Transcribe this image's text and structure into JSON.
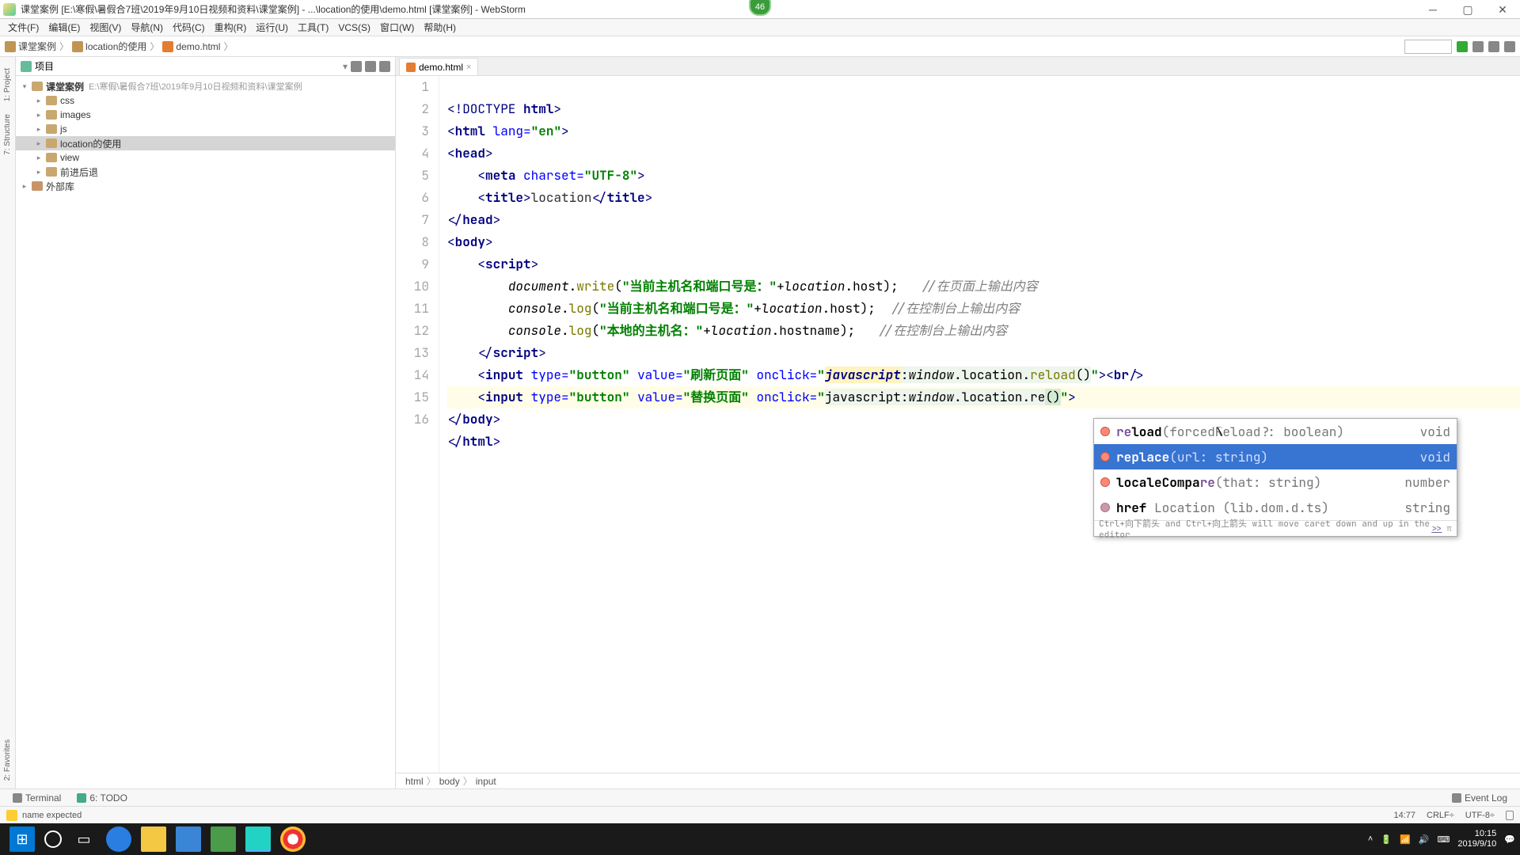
{
  "titlebar": {
    "text": "课堂案例 [E:\\寒假\\暑假合7班\\2019年9月10日视频和资料\\课堂案例] - ...\\location的使用\\demo.html [课堂案例] - WebStorm",
    "badge": "46"
  },
  "menu": {
    "file": "文件(F)",
    "edit": "编辑(E)",
    "view": "视图(V)",
    "navigate": "导航(N)",
    "code": "代码(C)",
    "refactor": "重构(R)",
    "run": "运行(U)",
    "tools": "工具(T)",
    "vcs": "VCS(S)",
    "window": "窗口(W)",
    "help": "帮助(H)"
  },
  "breadcrumbs": [
    "课堂案例",
    "location的使用",
    "demo.html"
  ],
  "toolbar_right_select": "",
  "left_rail": {
    "project": "1: Project",
    "structure": "7: Structure",
    "favorites": "2: Favorites"
  },
  "project_panel": {
    "title": "项目",
    "root": {
      "label": "课堂案例",
      "path": "E:\\寒假\\暑假合7班\\2019年9月10日视频和资料\\课堂案例"
    },
    "items": [
      "css",
      "images",
      "js",
      "location的使用",
      "view",
      "前进后退",
      "外部库"
    ]
  },
  "tab": {
    "file": "demo.html"
  },
  "code": {
    "lines": [
      "1",
      "2",
      "3",
      "4",
      "5",
      "6",
      "7",
      "8",
      "9",
      "10",
      "11",
      "12",
      "13",
      "14",
      "15",
      "16"
    ],
    "l9_str": "\"当前主机名和端口号是：\"",
    "l9_cmt": "//在页面上输出内容",
    "l10_str": "\"当前主机名和端口号是：\"",
    "l10_cmt": "//在控制台上输出内容",
    "l11_str": "\"本地的主机名：\"",
    "l11_cmt": "//在控制台上输出内容",
    "l13_val": "\"刷新页面\"",
    "l14_val": "\"替换页面\""
  },
  "completion": {
    "items": [
      {
        "name": "reload",
        "sig": "(forcedReload?: boolean)",
        "ret": "void",
        "kind": "m",
        "match": "re"
      },
      {
        "name": "replace",
        "sig": "(url: string)",
        "ret": "void",
        "kind": "m",
        "match": "re"
      },
      {
        "name": "localeCompare",
        "sig": "(that: string)",
        "ret": "number",
        "kind": "m",
        "match": "re"
      },
      {
        "name": "href",
        "sig": " Location (lib.dom.d.ts)",
        "ret": "string",
        "kind": "p",
        "match": ""
      }
    ],
    "selected_index": 1,
    "hint": "Ctrl+向下箭头 and Ctrl+向上箭头 will move caret down and up in the editor",
    "hint_link": ">>"
  },
  "bottom_crumbs": [
    "html",
    "body",
    "input"
  ],
  "bottom_tabs": {
    "terminal": "Terminal",
    "todo": "6: TODO",
    "event_log": "Event Log"
  },
  "status": {
    "msg": "name expected",
    "pos": "14:77",
    "line_sep": "CRLF÷",
    "encoding": "UTF-8÷"
  },
  "clock": {
    "time": "10:15",
    "date": "2019/9/10"
  }
}
